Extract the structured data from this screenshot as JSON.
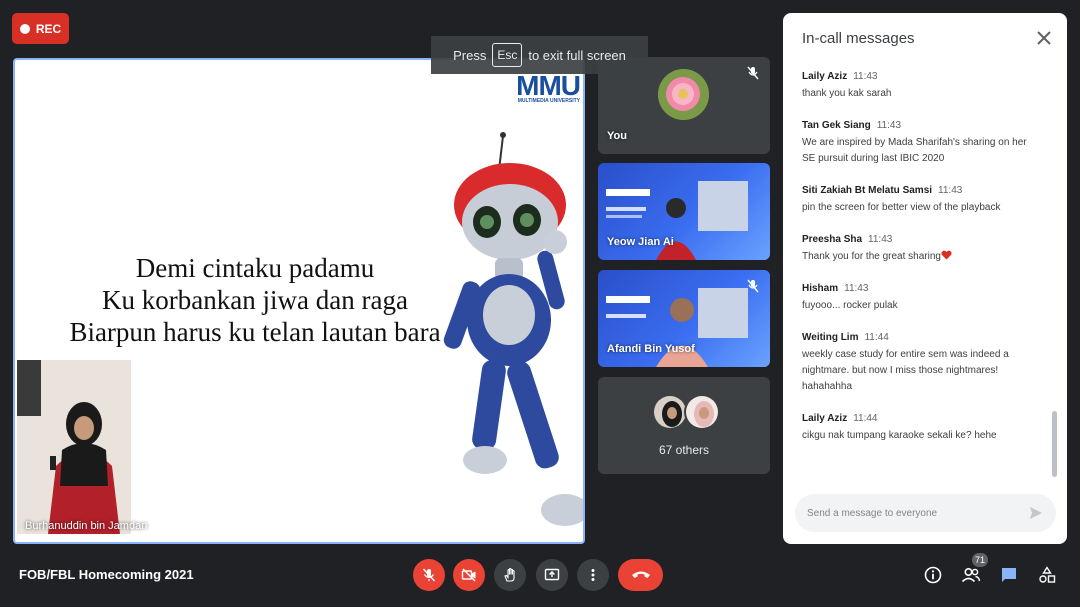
{
  "recording": {
    "label": "REC"
  },
  "fullscreen_banner": {
    "press": "Press",
    "key": "Esc",
    "suffix": "to exit full screen"
  },
  "presentation": {
    "logo": "MMU",
    "logo_subtitle": "MULTIMEDIA UNIVERSITY",
    "lyrics": [
      "Demi cintaku padamu",
      "Ku korbankan jiwa dan raga",
      "Biarpun harus ku telan lautan bara"
    ],
    "speaker_name": "Burhanuddin bin Jamdan"
  },
  "participants": [
    {
      "name": "You",
      "muted": true
    },
    {
      "name": "Yeow Jian Ai",
      "muted": false
    },
    {
      "name": "Afandi Bin Yusof",
      "muted": true
    }
  ],
  "others": {
    "label": "67 others"
  },
  "chat": {
    "title": "In-call messages",
    "input_placeholder": "Send a message to everyone",
    "messages": [
      {
        "sender": "Laily Aziz",
        "time": "11:43",
        "text": "thank you kak sarah"
      },
      {
        "sender": "Tan Gek Siang",
        "time": "11:43",
        "text": "We are inspired by Mada Sharifah's sharing on her SE pursuit during last IBIC 2020"
      },
      {
        "sender": "Siti Zakiah Bt Melatu Samsi",
        "time": "11:43",
        "text": "pin the screen for better view of the playback"
      },
      {
        "sender": "Preesha Sha",
        "time": "11:43",
        "text": "Thank you for the great sharing"
      },
      {
        "sender": "Hisham",
        "time": "11:43",
        "text": "fuyooo... rocker pulak"
      },
      {
        "sender": "Weiting Lim",
        "time": "11:44",
        "text": "weekly case study for entire sem was indeed a nightmare. but now I miss those nightmares! hahahahha"
      },
      {
        "sender": "Laily Aziz",
        "time": "11:44",
        "text": "cikgu nak tumpang karaoke sekali ke? hehe"
      }
    ]
  },
  "meeting": {
    "title": "FOB/FBL Homecoming 2021",
    "participant_count": "71"
  },
  "colors": {
    "accent": "#8ab4f8",
    "danger": "#ea4335",
    "background": "#202124",
    "tile": "#3c4043"
  }
}
